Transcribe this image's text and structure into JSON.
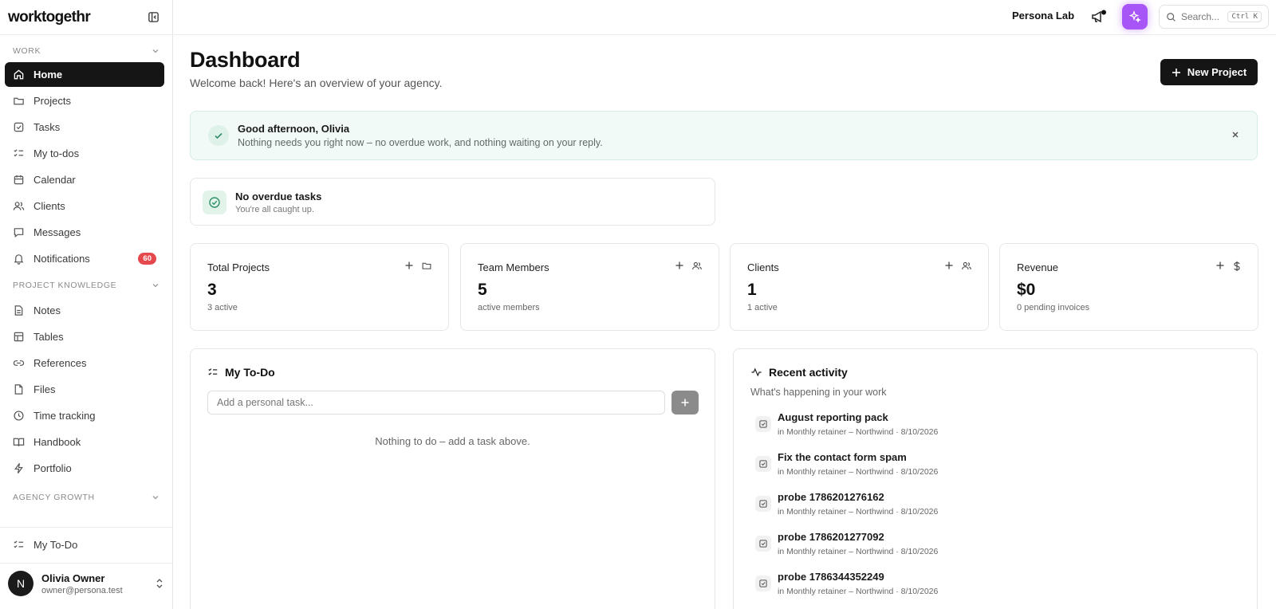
{
  "app": {
    "logo": "worktogethr",
    "workspace": "Persona Lab",
    "search_placeholder": "Search...",
    "search_shortcut": "Ctrl K"
  },
  "sidebar": {
    "sections": {
      "work": "WORK",
      "knowledge": "PROJECT KNOWLEDGE",
      "growth": "AGENCY GROWTH"
    },
    "work_items": [
      {
        "label": "Home",
        "icon": "home-icon",
        "active": true
      },
      {
        "label": "Projects",
        "icon": "folder-icon"
      },
      {
        "label": "Tasks",
        "icon": "checkbox-icon"
      },
      {
        "label": "My to-dos",
        "icon": "list-check-icon"
      },
      {
        "label": "Calendar",
        "icon": "calendar-icon"
      },
      {
        "label": "Clients",
        "icon": "users-icon"
      },
      {
        "label": "Messages",
        "icon": "message-icon"
      },
      {
        "label": "Notifications",
        "icon": "bell-icon",
        "badge": "60"
      }
    ],
    "knowledge_items": [
      {
        "label": "Notes",
        "icon": "note-icon"
      },
      {
        "label": "Tables",
        "icon": "table-icon"
      },
      {
        "label": "References",
        "icon": "link-icon"
      },
      {
        "label": "Files",
        "icon": "file-icon"
      },
      {
        "label": "Time tracking",
        "icon": "clock-icon"
      },
      {
        "label": "Handbook",
        "icon": "book-icon"
      },
      {
        "label": "Portfolio",
        "icon": "bolt-icon"
      }
    ],
    "bottom_item": {
      "label": "My To-Do",
      "icon": "list-check-icon"
    },
    "user": {
      "initial": "N",
      "name": "Olivia Owner",
      "email": "owner@persona.test"
    }
  },
  "page": {
    "title": "Dashboard",
    "subtitle": "Welcome back! Here's an overview of your agency.",
    "new_project_label": "New Project"
  },
  "greeting": {
    "title": "Good afternoon, Olivia",
    "text": "Nothing needs you right now – no overdue work, and nothing waiting on your reply."
  },
  "overdue": {
    "title": "No overdue tasks",
    "subtitle": "You're all caught up."
  },
  "stats": [
    {
      "label": "Total Projects",
      "value": "3",
      "sub": "3 active",
      "icon": "folder-icon"
    },
    {
      "label": "Team Members",
      "value": "5",
      "sub": "active members",
      "icon": "users-icon"
    },
    {
      "label": "Clients",
      "value": "1",
      "sub": "1 active",
      "icon": "users-icon"
    },
    {
      "label": "Revenue",
      "value": "$0",
      "sub": "0 pending invoices",
      "icon": "dollar-icon"
    }
  ],
  "todo": {
    "title": "My To-Do",
    "placeholder": "Add a personal task...",
    "empty": "Nothing to do – add a task above."
  },
  "activity": {
    "title": "Recent activity",
    "subtitle": "What's happening in your work",
    "items": [
      {
        "title": "August reporting pack",
        "meta": "in Monthly retainer – Northwind · 8/10/2026"
      },
      {
        "title": "Fix the contact form spam",
        "meta": "in Monthly retainer – Northwind · 8/10/2026"
      },
      {
        "title": "probe 1786201276162",
        "meta": "in Monthly retainer – Northwind · 8/10/2026"
      },
      {
        "title": "probe 1786201277092",
        "meta": "in Monthly retainer – Northwind · 8/10/2026"
      },
      {
        "title": "probe 1786344352249",
        "meta": "in Monthly retainer – Northwind · 8/10/2026"
      }
    ]
  }
}
